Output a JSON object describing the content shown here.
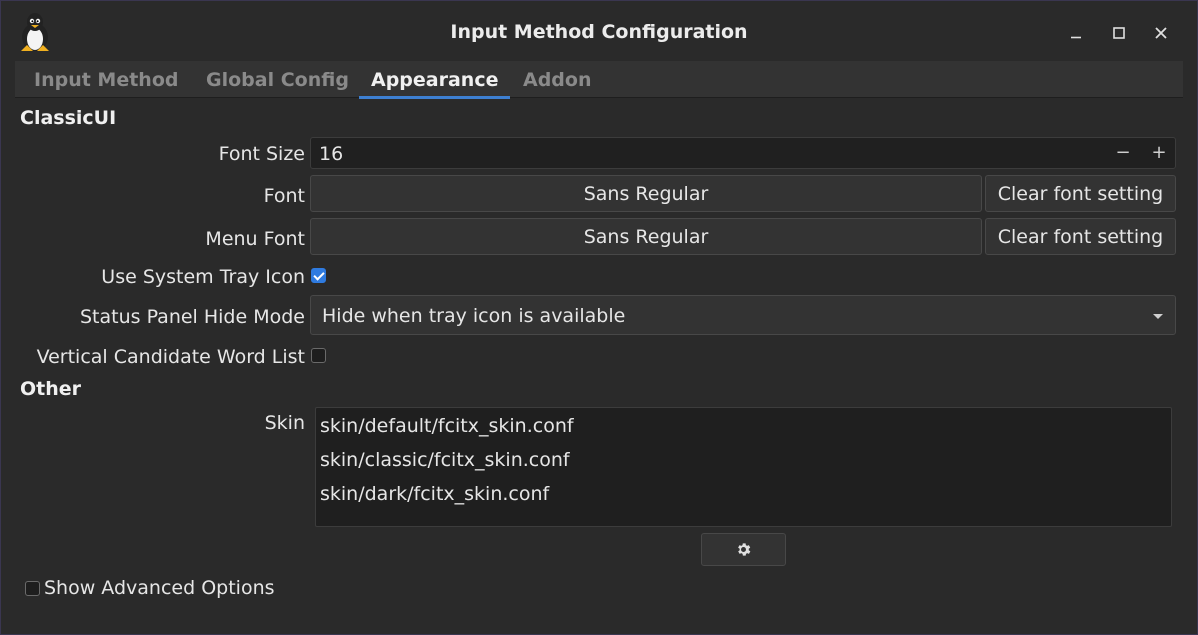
{
  "window": {
    "title": "Input Method Configuration",
    "app_icon": "tux-icon",
    "controls": {
      "minimize_icon": "minimize-icon",
      "maximize_icon": "maximize-icon",
      "close_icon": "close-icon"
    }
  },
  "tabs": [
    {
      "label": "Input Method",
      "active": false
    },
    {
      "label": "Global Config",
      "active": false
    },
    {
      "label": "Appearance",
      "active": true
    },
    {
      "label": "Addon",
      "active": false
    }
  ],
  "classic_ui": {
    "section_title": "ClassicUI",
    "font_size": {
      "label": "Font Size",
      "value": "16",
      "decrement": "−",
      "increment": "+"
    },
    "font": {
      "label": "Font",
      "value": "Sans Regular",
      "clear_label": "Clear font setting"
    },
    "menu_font": {
      "label": "Menu Font",
      "value": "Sans Regular",
      "clear_label": "Clear font setting"
    },
    "use_tray_icon": {
      "label": "Use System Tray Icon",
      "checked": true
    },
    "status_panel": {
      "label": "Status Panel Hide Mode",
      "value": "Hide when tray icon is available"
    },
    "vertical_list": {
      "label": "Vertical Candidate Word List",
      "checked": false
    }
  },
  "other": {
    "section_title": "Other",
    "skin": {
      "label": "Skin",
      "items": [
        "skin/default/fcitx_skin.conf",
        "skin/classic/fcitx_skin.conf",
        "skin/dark/fcitx_skin.conf"
      ],
      "settings_icon": "gear-icon"
    }
  },
  "advanced": {
    "label": "Show Advanced Options",
    "checked": false
  },
  "colors": {
    "accent": "#3d7fd1",
    "background": "#2a2a2a",
    "checkbox_checked": "#2f7be0"
  }
}
